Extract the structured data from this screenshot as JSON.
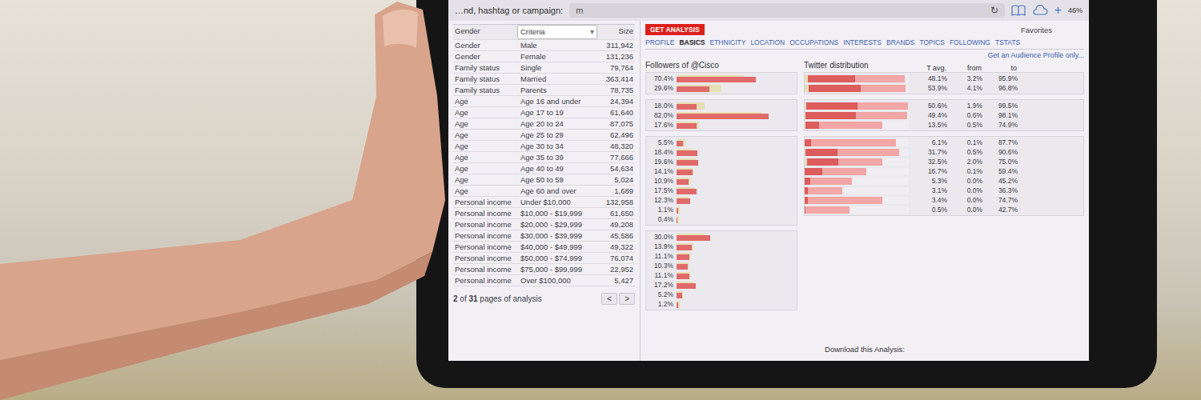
{
  "topbar": {
    "url_fragment": "m",
    "search_label": "…nd, hashtag or campaign:",
    "reload": "↻",
    "plus": "+",
    "battery": "46%"
  },
  "action_row": {
    "button": "GET ANALYSIS",
    "favorites": "Favorites",
    "link": "Get an Audience Profile only..."
  },
  "tabs": [
    {
      "label": "PROFILE",
      "selected": false
    },
    {
      "label": "BASICS",
      "selected": true
    },
    {
      "label": "ETHNICITY",
      "selected": false
    },
    {
      "label": "LOCATION",
      "selected": false
    },
    {
      "label": "OCCUPATIONS",
      "selected": false
    },
    {
      "label": "INTERESTS",
      "selected": false
    },
    {
      "label": "BRANDS",
      "selected": false
    },
    {
      "label": "TOPICS",
      "selected": false
    },
    {
      "label": "FOLLOWING",
      "selected": false
    },
    {
      "label": "TSTATS",
      "selected": false
    }
  ],
  "table": {
    "columns": [
      "Gender",
      "Criteria",
      "Size"
    ],
    "criteria_arrow": "▾",
    "rows": [
      {
        "category": "Gender",
        "criteria": "Male",
        "size": "311,942"
      },
      {
        "category": "Gender",
        "criteria": "Female",
        "size": "131,236"
      },
      {
        "category": "Family status",
        "criteria": "Single",
        "size": "79,764"
      },
      {
        "category": "Family status",
        "criteria": "Married",
        "size": "363,414"
      },
      {
        "category": "Family status",
        "criteria": "Parents",
        "size": "78,735"
      },
      {
        "category": "Age",
        "criteria": "Age 16 and under",
        "size": "24,394"
      },
      {
        "category": "Age",
        "criteria": "Age 17 to 19",
        "size": "61,640"
      },
      {
        "category": "Age",
        "criteria": "Age 20 to 24",
        "size": "87,075"
      },
      {
        "category": "Age",
        "criteria": "Age 25 to 29",
        "size": "62,496"
      },
      {
        "category": "Age",
        "criteria": "Age 30 to 34",
        "size": "48,320"
      },
      {
        "category": "Age",
        "criteria": "Age 35 to 39",
        "size": "77,666"
      },
      {
        "category": "Age",
        "criteria": "Age 40 to 49",
        "size": "54,634"
      },
      {
        "category": "Age",
        "criteria": "Age 50 to 59",
        "size": "5,024"
      },
      {
        "category": "Age",
        "criteria": "Age 60 and over",
        "size": "1,689"
      },
      {
        "category": "Personal income",
        "criteria": "Under $10,000",
        "size": "132,958"
      },
      {
        "category": "Personal income",
        "criteria": "$10,000 - $19,999",
        "size": "61,650"
      },
      {
        "category": "Personal income",
        "criteria": "$20,000 - $29,999",
        "size": "49,208"
      },
      {
        "category": "Personal income",
        "criteria": "$30,000 - $39,999",
        "size": "45,586"
      },
      {
        "category": "Personal income",
        "criteria": "$40,000 - $49,999",
        "size": "49,322"
      },
      {
        "category": "Personal income",
        "criteria": "$50,000 - $74,999",
        "size": "76,074"
      },
      {
        "category": "Personal income",
        "criteria": "$75,000 - $99,999",
        "size": "22,952"
      },
      {
        "category": "Personal income",
        "criteria": "Over $100,000",
        "size": "5,427"
      }
    ]
  },
  "pager": {
    "current": "2",
    "of": "of",
    "total": "31",
    "suffix": "pages of analysis",
    "prev": "<",
    "next": ">"
  },
  "followers_chart": {
    "title": "Followers of @Cisco",
    "groups": [
      [
        {
          "label": "70.4%",
          "value": 70.4,
          "benchmark": 60
        },
        {
          "label": "29.6%",
          "value": 29.6,
          "benchmark": 40
        }
      ],
      [
        {
          "label": "18.0%",
          "value": 18.0,
          "benchmark": 25
        },
        {
          "label": "82.0%",
          "value": 82.0,
          "benchmark": 75
        },
        {
          "label": "17.6%",
          "value": 17.6,
          "benchmark": 20
        }
      ],
      [
        {
          "label": "5.5%",
          "value": 5.5,
          "benchmark": 8
        },
        {
          "label": "18.4%",
          "value": 18.4,
          "benchmark": 15
        },
        {
          "label": "19.6%",
          "value": 19.6,
          "benchmark": 17
        },
        {
          "label": "14.1%",
          "value": 14.1,
          "benchmark": 15
        },
        {
          "label": "10.9%",
          "value": 10.9,
          "benchmark": 12
        },
        {
          "label": "17.5%",
          "value": 17.5,
          "benchmark": 16
        },
        {
          "label": "12.3%",
          "value": 12.3,
          "benchmark": 11
        },
        {
          "label": "1.1%",
          "value": 1.1,
          "benchmark": 3
        },
        {
          "label": "0.4%",
          "value": 0.4,
          "benchmark": 2
        }
      ],
      [
        {
          "label": "30.0%",
          "value": 30.0,
          "benchmark": 25
        },
        {
          "label": "13.9%",
          "value": 13.9,
          "benchmark": 15
        },
        {
          "label": "11.1%",
          "value": 11.1,
          "benchmark": 12
        },
        {
          "label": "10.3%",
          "value": 10.3,
          "benchmark": 11
        },
        {
          "label": "11.1%",
          "value": 11.1,
          "benchmark": 12
        },
        {
          "label": "17.2%",
          "value": 17.2,
          "benchmark": 15
        },
        {
          "label": "5.2%",
          "value": 5.2,
          "benchmark": 6
        },
        {
          "label": "1.2%",
          "value": 1.2,
          "benchmark": 3
        }
      ]
    ]
  },
  "distribution": {
    "title": "Twitter distribution",
    "columns": [
      "T avg.",
      "from",
      "to"
    ],
    "groups": [
      [
        {
          "avg": "48.1%",
          "from": "3.2%",
          "to": "95.9%",
          "values": [
            48.1,
            3.2,
            95.9
          ]
        },
        {
          "avg": "53.9%",
          "from": "4.1%",
          "to": "96.8%",
          "values": [
            53.9,
            4.1,
            96.8
          ]
        }
      ],
      [
        {
          "avg": "50.6%",
          "from": "1.9%",
          "to": "99.5%",
          "values": [
            50.6,
            1.9,
            99.5
          ]
        },
        {
          "avg": "49.4%",
          "from": "0.6%",
          "to": "98.1%",
          "values": [
            49.4,
            0.6,
            98.1
          ]
        },
        {
          "avg": "13.5%",
          "from": "0.5%",
          "to": "74.9%",
          "values": [
            13.5,
            0.5,
            74.9
          ]
        }
      ],
      [
        {
          "avg": "6.1%",
          "from": "0.1%",
          "to": "87.7%",
          "values": [
            6.1,
            0.1,
            87.7
          ]
        },
        {
          "avg": "31.7%",
          "from": "0.5%",
          "to": "90.6%",
          "values": [
            31.7,
            0.5,
            90.6
          ]
        },
        {
          "avg": "32.5%",
          "from": "2.0%",
          "to": "75.0%",
          "values": [
            32.5,
            2.0,
            75.0
          ]
        },
        {
          "avg": "16.7%",
          "from": "0.1%",
          "to": "59.4%",
          "values": [
            16.7,
            0.1,
            59.4
          ]
        },
        {
          "avg": "5.3%",
          "from": "0.0%",
          "to": "45.2%",
          "values": [
            5.3,
            0.0,
            45.2
          ]
        },
        {
          "avg": "3.1%",
          "from": "0.0%",
          "to": "36.3%",
          "values": [
            3.1,
            0.0,
            36.3
          ]
        },
        {
          "avg": "3.4%",
          "from": "0.0%",
          "to": "74.7%",
          "values": [
            3.4,
            0.0,
            74.7
          ]
        },
        {
          "avg": "0.5%",
          "from": "0.0%",
          "to": "42.7%",
          "values": [
            0.5,
            0.0,
            42.7
          ]
        }
      ]
    ]
  },
  "download": "Download this Analysis:"
}
